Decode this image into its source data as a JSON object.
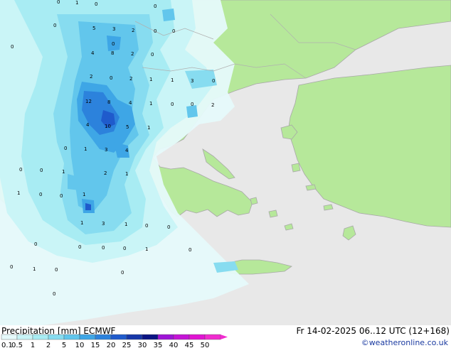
{
  "colors": {
    "sea": "#e8e8e8",
    "land": "#b6e89a",
    "coast": "#a0a0a0"
  },
  "map": {
    "precip_labels": [
      "0",
      "1",
      "0",
      "0",
      "0",
      "0",
      "5",
      "3",
      "2",
      "0",
      "0",
      "0",
      "4",
      "8",
      "2",
      "0",
      "2",
      "0",
      "2",
      "1",
      "1",
      "3",
      "0",
      "12",
      "8",
      "4",
      "1",
      "0",
      "0",
      "2",
      "4",
      "10",
      "5",
      "1",
      "1",
      "3",
      "4",
      "0",
      "0",
      "1",
      "2",
      "1",
      "0",
      "1",
      "1",
      "0",
      "0",
      "3",
      "1",
      "1",
      "0",
      "0",
      "0",
      "0",
      "0",
      "0",
      "1",
      "0",
      "0",
      "1",
      "0",
      "0",
      "0"
    ]
  },
  "footer": {
    "title": "Precipitation [mm] ECMWF",
    "datetime": "Fr 14-02-2025 06..12 UTC (12+168)",
    "credit": "©weatheronline.co.uk",
    "legend": [
      {
        "label": "0.1",
        "color": "#e6fafb"
      },
      {
        "label": "0.5",
        "color": "#c8f4f7"
      },
      {
        "label": "1",
        "color": "#a8ecf3"
      },
      {
        "label": "2",
        "color": "#87dcf0"
      },
      {
        "label": "5",
        "color": "#62c6ec"
      },
      {
        "label": "10",
        "color": "#3ea6e6"
      },
      {
        "label": "15",
        "color": "#2c82dc"
      },
      {
        "label": "20",
        "color": "#1f5bcc"
      },
      {
        "label": "25",
        "color": "#1637a8"
      },
      {
        "label": "30",
        "color": "#0b1484"
      },
      {
        "label": "35",
        "color": "#9e14d6"
      },
      {
        "label": "40",
        "color": "#c414d6"
      },
      {
        "label": "45",
        "color": "#e014d2"
      },
      {
        "label": "50",
        "color": "#f02ccf"
      }
    ]
  }
}
